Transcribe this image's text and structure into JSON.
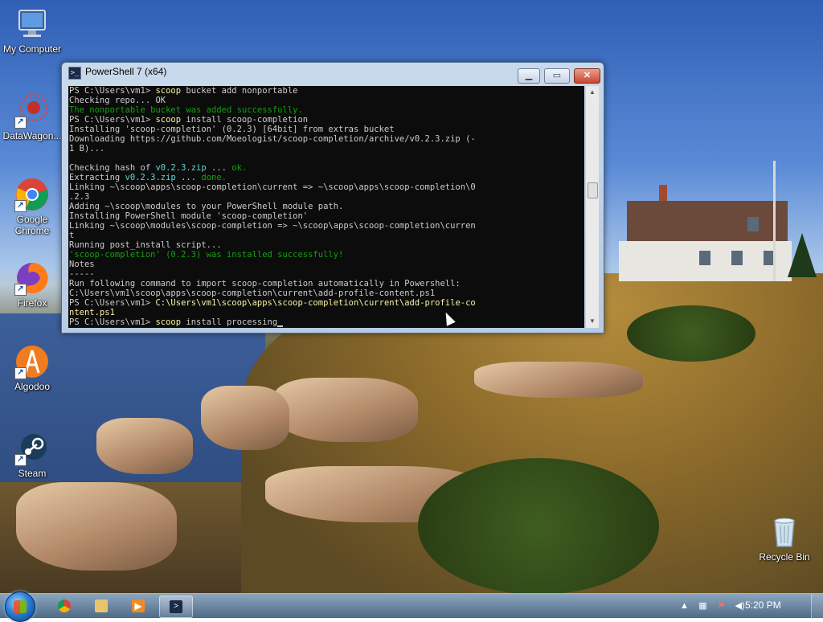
{
  "desktop": {
    "icons": [
      {
        "label": "My Computer"
      },
      {
        "label": "DataWagon..."
      },
      {
        "label": "Google Chrome"
      },
      {
        "label": "Firefox"
      },
      {
        "label": "Algodoo"
      },
      {
        "label": "Steam"
      },
      {
        "label": "Recycle Bin"
      }
    ]
  },
  "window": {
    "title": "PowerShell 7 (x64)",
    "console": [
      [
        {
          "t": "PS C:\\Users\\vm1> "
        },
        {
          "t": "scoop",
          "c": "y"
        },
        {
          "t": " bucket add nonportable"
        }
      ],
      [
        {
          "t": "Checking repo... OK"
        }
      ],
      [
        {
          "t": "The nonportable bucket was added successfully.",
          "c": "g"
        }
      ],
      [
        {
          "t": "PS C:\\Users\\vm1> "
        },
        {
          "t": "scoop",
          "c": "y"
        },
        {
          "t": " install scoop-completion"
        }
      ],
      [
        {
          "t": "Installing 'scoop-completion' (0.2.3) [64bit] from extras bucket"
        }
      ],
      [
        {
          "t": "Downloading https://github.com/Moeologist/scoop-completion/archive/v0.2.3.zip (-"
        }
      ],
      [
        {
          "t": "1 B)..."
        }
      ],
      [
        {
          "t": ""
        }
      ],
      [
        {
          "t": "Checking hash of "
        },
        {
          "t": "v0.2.3.zip",
          "c": "c"
        },
        {
          "t": " ... "
        },
        {
          "t": "ok.",
          "c": "g"
        }
      ],
      [
        {
          "t": "Extracting "
        },
        {
          "t": "v0.2.3.zip",
          "c": "c"
        },
        {
          "t": " ... "
        },
        {
          "t": "done.",
          "c": "g"
        }
      ],
      [
        {
          "t": "Linking ~\\scoop\\apps\\scoop-completion\\current => ~\\scoop\\apps\\scoop-completion\\0"
        }
      ],
      [
        {
          "t": ".2.3"
        }
      ],
      [
        {
          "t": "Adding ~\\scoop\\modules to your PowerShell module path."
        }
      ],
      [
        {
          "t": "Installing PowerShell module 'scoop-completion'"
        }
      ],
      [
        {
          "t": "Linking ~\\scoop\\modules\\scoop-completion => ~\\scoop\\apps\\scoop-completion\\curren"
        }
      ],
      [
        {
          "t": "t"
        }
      ],
      [
        {
          "t": "Running post_install script..."
        }
      ],
      [
        {
          "t": "'scoop-completion' (0.2.3) was installed successfully!",
          "c": "g"
        }
      ],
      [
        {
          "t": "Notes"
        }
      ],
      [
        {
          "t": "-----"
        }
      ],
      [
        {
          "t": "Run following command to import scoop-completion automatically in Powershell:"
        }
      ],
      [
        {
          "t": "C:\\Users\\vm1\\scoop\\apps\\scoop-completion\\current\\add-profile-content.ps1"
        }
      ],
      [
        {
          "t": "PS C:\\Users\\vm1> "
        },
        {
          "t": "C:\\Users\\vm1\\scoop\\apps\\scoop-completion\\current\\add-profile-co",
          "c": "y"
        }
      ],
      [
        {
          "t": "ntent.ps1",
          "c": "y"
        }
      ],
      [
        {
          "t": "PS C:\\Users\\vm1> "
        },
        {
          "t": "scoop",
          "c": "y"
        },
        {
          "t": " install processing"
        },
        {
          "cursor": true
        }
      ]
    ]
  },
  "taskbar": {
    "clock": "5:20 PM",
    "items": [
      "chrome",
      "file-explorer",
      "media-player",
      "powershell"
    ]
  },
  "colors": {
    "console_bg": "#0c0c0c",
    "console_fg": "#cccccc",
    "command": "#f9f1a5",
    "success": "#13a10e",
    "filename": "#61d6d6"
  }
}
